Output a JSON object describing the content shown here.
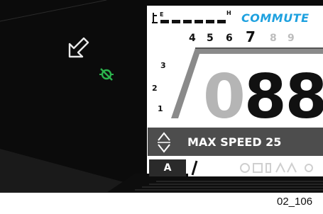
{
  "display": {
    "mode_label": "COMMUTE",
    "fuel_label_empty": "E",
    "fuel_label_full": "H",
    "gears": [
      "4",
      "5",
      "6",
      "7",
      "8",
      "9"
    ],
    "rpm_scale": [
      "1",
      "2",
      "3"
    ],
    "speed_dim": "0",
    "speed_main": "88",
    "message": "MAX SPEED 25",
    "mode_button": "A",
    "figure_caption": "02_106"
  },
  "colors": {
    "mode_text": "#1ea1df",
    "indicator_green": "#2bb24c",
    "bezel": "#111111"
  },
  "icons": {
    "arrow": "return-arrow-icon",
    "indicator": "engine-check-icon",
    "updown": "up-down-arrows-icon",
    "status_row": "status-icons"
  }
}
